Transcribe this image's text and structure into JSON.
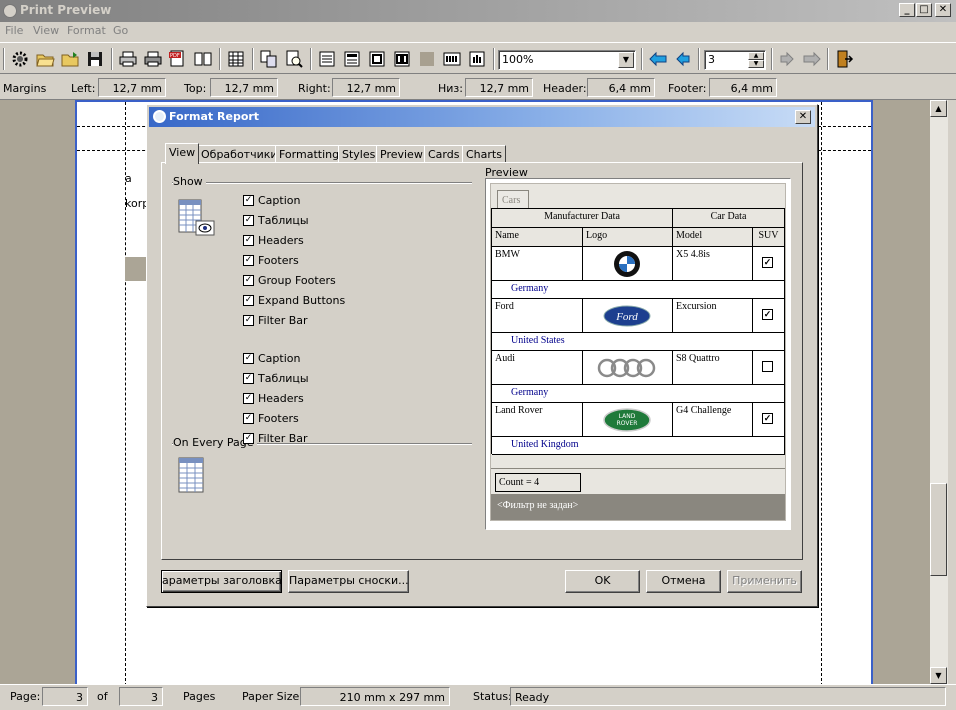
{
  "window": {
    "title": "Print Preview"
  },
  "menu": [
    "File",
    "View",
    "Format",
    "Go"
  ],
  "toolbar": {
    "zoom": "100%",
    "page_number": "3"
  },
  "margins": {
    "label": "Margins",
    "left_label": "Left:",
    "left": "12,7 mm",
    "top_label": "Top:",
    "top": "12,7 mm",
    "right_label": "Right:",
    "right": "12,7 mm",
    "bottom_label": "Низ:",
    "bottom": "12,7 mm",
    "header_label": "Header:",
    "header": "6,4 mm",
    "footer_label": "Footer:",
    "footer": "6,4 mm"
  },
  "background_fragments": [
    "a",
    "korp"
  ],
  "statusbar": {
    "page_label": "Page:",
    "page": "3",
    "of_label": "of",
    "total": "3",
    "pages_label": "Pages",
    "paper_label": "Paper Size:",
    "paper": "210 mm x 297 mm",
    "status_label": "Status:",
    "status": "Ready"
  },
  "dialog": {
    "title": "Format Report",
    "tabs": [
      "View",
      "Обработчики",
      "Formatting",
      "Styles",
      "Preview",
      "Cards",
      "Charts"
    ],
    "show_group": "Show",
    "show_items": [
      {
        "label": "Caption",
        "checked": true
      },
      {
        "label": "Таблицы",
        "checked": true
      },
      {
        "label": "Headers",
        "checked": true
      },
      {
        "label": "Footers",
        "checked": true
      },
      {
        "label": "Group Footers",
        "checked": true
      },
      {
        "label": "Expand Buttons",
        "checked": true
      },
      {
        "label": "Filter Bar",
        "checked": true
      }
    ],
    "every_page_group": "On Every Page",
    "every_page_items": [
      {
        "label": "Caption",
        "checked": true
      },
      {
        "label": "Таблицы",
        "checked": true
      },
      {
        "label": "Headers",
        "checked": true
      },
      {
        "label": "Footers",
        "checked": true
      },
      {
        "label": "Filter Bar",
        "checked": true
      }
    ],
    "preview": {
      "label": "Preview",
      "tab": "Cars",
      "band_manufacturer": "Manufacturer Data",
      "band_car": "Car Data",
      "columns": [
        "Name",
        "Logo",
        "Model",
        "SUV"
      ],
      "rows": [
        {
          "name": "BMW",
          "logo": "bmw-logo",
          "model": "X5 4.8is",
          "suv": true,
          "group": "Germany"
        },
        {
          "name": "Ford",
          "logo": "ford-logo",
          "model": "Excursion",
          "suv": true,
          "group": "United States"
        },
        {
          "name": "Audi",
          "logo": "audi-logo",
          "model": "S8 Quattro",
          "suv": false,
          "group": "Germany"
        },
        {
          "name": "Land Rover",
          "logo": "land-rover-logo",
          "model": "G4 Challenge",
          "suv": true,
          "group": "United Kingdom"
        }
      ],
      "ford_logo_text": "Ford",
      "land_rover_logo_text": [
        "LAND",
        "ROVER"
      ],
      "count": "Count = 4",
      "filter": "<Фильтр не задан>"
    },
    "buttons": {
      "header_params": "араметры заголовка...",
      "footer_params": "Параметры сноски...",
      "ok": "OK",
      "cancel": "Отмена",
      "apply": "Применить"
    }
  }
}
